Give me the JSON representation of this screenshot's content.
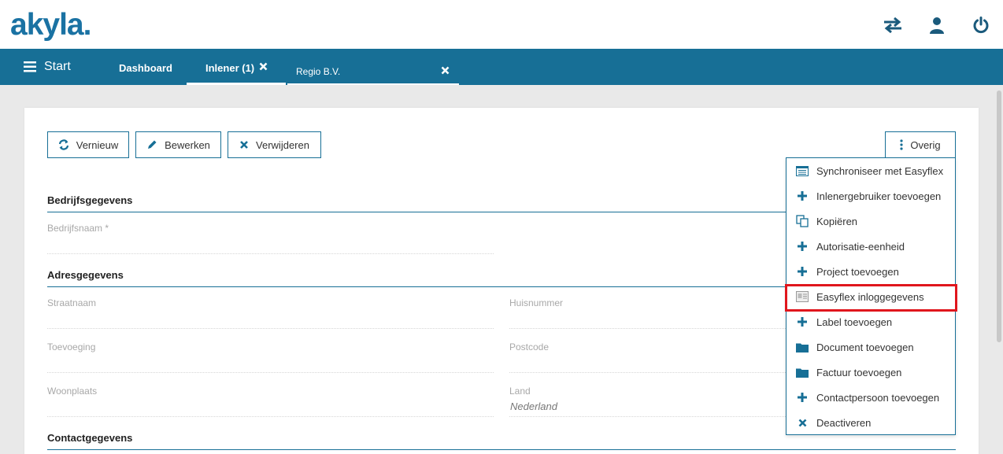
{
  "header": {
    "logo": "akyla."
  },
  "nav": {
    "start_label": "Start",
    "tabs": [
      {
        "label": "Dashboard"
      },
      {
        "label": "Inlener (1)"
      },
      {
        "label": "Regio B.V."
      }
    ]
  },
  "toolbar": {
    "vernieuw": "Vernieuw",
    "bewerken": "Bewerken",
    "verwijderen": "Verwijderen",
    "overig": "Overig"
  },
  "sections": {
    "bedrijf": {
      "title": "Bedrijfsgegevens",
      "bedrijfsnaam_label": "Bedrijfsnaam *"
    },
    "adres": {
      "title": "Adresgegevens",
      "straatnaam_label": "Straatnaam",
      "huisnummer_label": "Huisnummer",
      "toevoeging_label": "Toevoeging",
      "postcode_label": "Postcode",
      "woonplaats_label": "Woonplaats",
      "land_label": "Land",
      "land_value": "Nederland"
    },
    "contact": {
      "title": "Contactgegevens"
    }
  },
  "menu": {
    "items": [
      {
        "label": "Synchroniseer met Easyflex",
        "icon": "list-icon"
      },
      {
        "label": "Inlenergebruiker toevoegen",
        "icon": "plus-icon"
      },
      {
        "label": "Kopiëren",
        "icon": "copy-icon"
      },
      {
        "label": "Autorisatie-eenheid",
        "icon": "plus-icon"
      },
      {
        "label": "Project toevoegen",
        "icon": "plus-icon"
      },
      {
        "label": "Easyflex inloggegevens",
        "icon": "credentials-icon"
      },
      {
        "label": "Label toevoegen",
        "icon": "plus-icon"
      },
      {
        "label": "Document toevoegen",
        "icon": "folder-icon"
      },
      {
        "label": "Factuur toevoegen",
        "icon": "folder-icon"
      },
      {
        "label": "Contactpersoon toevoegen",
        "icon": "plus-icon"
      },
      {
        "label": "Deactiveren",
        "icon": "close-icon"
      }
    ],
    "highlighted_index": 5
  },
  "colors": {
    "primary": "#176f96",
    "logo": "#1a72a3",
    "highlight": "#e0161d"
  }
}
